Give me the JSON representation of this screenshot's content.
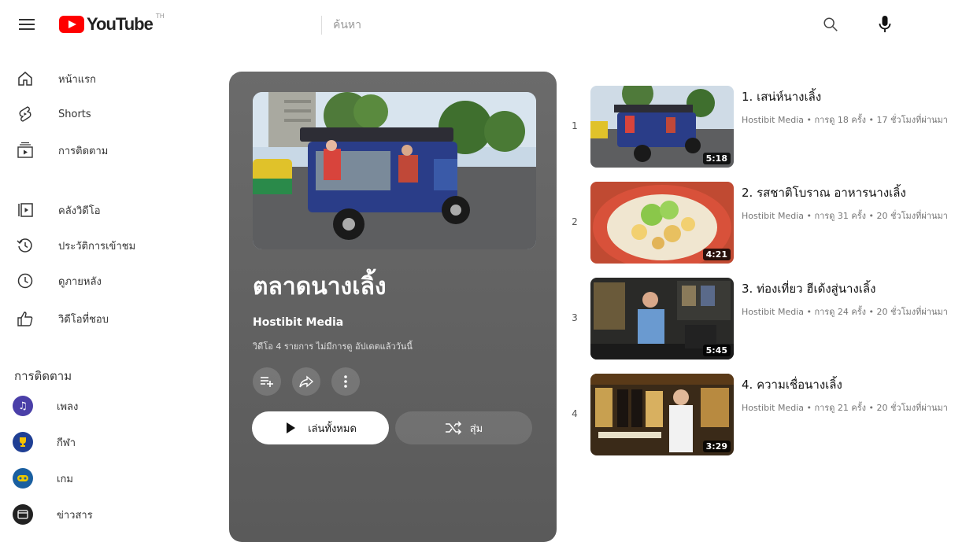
{
  "header": {
    "logo_text": "YouTube",
    "logo_region": "TH",
    "search_placeholder": "ค้นหา",
    "search_icon": "search-icon",
    "mic_icon": "mic-icon",
    "menu_icon": "hamburger-menu-icon"
  },
  "sidebar": {
    "items": [
      {
        "label": "หน้าแรก",
        "icon": "home-icon"
      },
      {
        "label": "Shorts",
        "icon": "shorts-icon"
      },
      {
        "label": "การติดตาม",
        "icon": "subscriptions-icon"
      },
      {
        "label": "คลังวิดีโอ",
        "icon": "library-icon"
      },
      {
        "label": "ประวัติการเข้าชม",
        "icon": "history-icon"
      },
      {
        "label": "ดูภายหลัง",
        "icon": "watch-later-icon"
      },
      {
        "label": "วิดีโอที่ชอบ",
        "icon": "like-icon"
      }
    ],
    "section_title": "การติดตาม",
    "subscriptions": [
      {
        "label": "เพลง",
        "icon": "music-icon",
        "color": "#4a3fa8"
      },
      {
        "label": "กีฬา",
        "icon": "trophy-icon",
        "color": "#1f3f94"
      },
      {
        "label": "เกม",
        "icon": "gaming-icon",
        "color": "#1a5fa0"
      },
      {
        "label": "ข่าวสาร",
        "icon": "news-icon",
        "color": "#222222"
      }
    ]
  },
  "playlist": {
    "title": "ตลาดนางเลิ้ง",
    "owner": "Hostibit Media",
    "meta": "วิดีโอ 4 รายการ  ไม่มีการดู  อัปเดตแล้ววันนี้",
    "play_all_label": "เล่นทั้งหมด",
    "shuffle_label": "สุ่ม"
  },
  "videos": [
    {
      "index": "1",
      "title": "1. เสน่ห์นางเลิ้ง",
      "meta": "Hostibit Media • การดู 18 ครั้ง • 17 ชั่วโมงที่ผ่านมา",
      "duration": "5:18"
    },
    {
      "index": "2",
      "title": "2. รสชาติโบราณ อาหารนางเลิ้ง",
      "meta": "Hostibit Media • การดู 31 ครั้ง • 20 ชั่วโมงที่ผ่านมา",
      "duration": "4:21"
    },
    {
      "index": "3",
      "title": "3. ท่องเที่ยว ฮีเด้งสู่นางเลิ้ง",
      "meta": "Hostibit Media • การดู 24 ครั้ง • 20 ชั่วโมงที่ผ่านมา",
      "duration": "5:45"
    },
    {
      "index": "4",
      "title": "4. ความเชื่อนางเลิ้ง",
      "meta": "Hostibit Media • การดู 21 ครั้ง • 20 ชั่วโมงที่ผ่านมา",
      "duration": "3:29"
    }
  ]
}
